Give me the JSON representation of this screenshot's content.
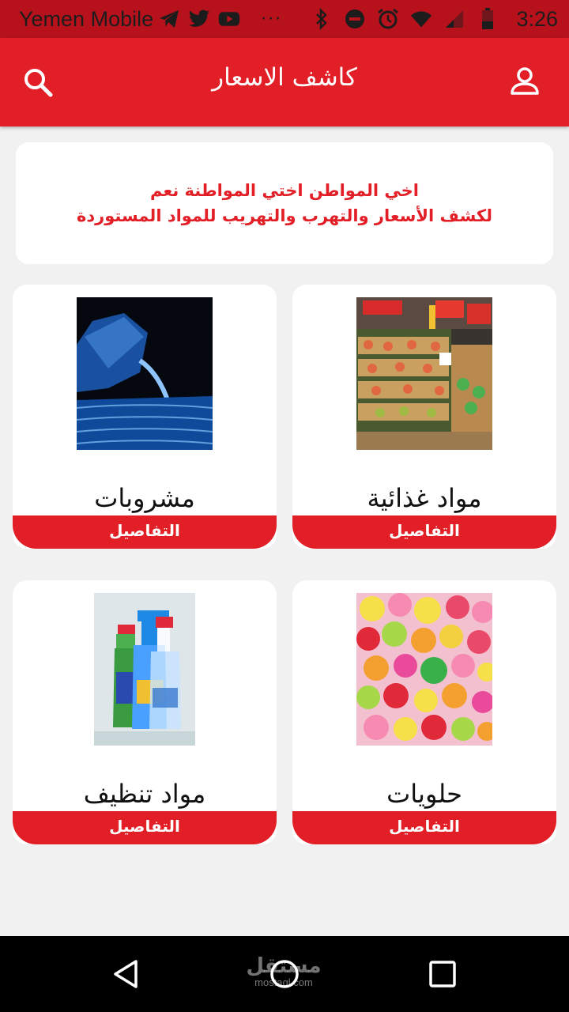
{
  "status_bar": {
    "carrier": "Yemen Mobile",
    "time": "3:26",
    "left_icons": [
      "telegram-icon",
      "twitter-icon",
      "youtube-icon"
    ],
    "more": "···",
    "right_icons": [
      "bluetooth-icon",
      "do-not-disturb-icon",
      "alarm-icon",
      "wifi-icon",
      "signal-icon",
      "battery-icon"
    ]
  },
  "app_bar": {
    "title": "كاشف الاسعار",
    "search_icon": "search-icon",
    "profile_icon": "user-icon",
    "color": "#e21e26"
  },
  "notice": {
    "line1": "اخي المواطن اختي المواطنة نعم",
    "line2": "لكشف الأسعار والتهرب والتهريب للمواد المستوردة"
  },
  "categories": [
    {
      "label": "مواد غذائية",
      "button": "التفاصيل",
      "image": "supermarket-produce-photo"
    },
    {
      "label": "مشروبات",
      "button": "التفاصيل",
      "image": "water-bottle-photo"
    },
    {
      "label": "حلويات",
      "button": "التفاصيل",
      "image": "colorful-candies-photo"
    },
    {
      "label": "مواد تنظيف",
      "button": "التفاصيل",
      "image": "cleaning-spray-bottles-photo"
    }
  ],
  "nav_bar": {
    "icons": [
      "back-icon",
      "home-icon",
      "recents-icon"
    ],
    "watermark_ar": "مستقل",
    "watermark_en": "mostaql.com"
  }
}
